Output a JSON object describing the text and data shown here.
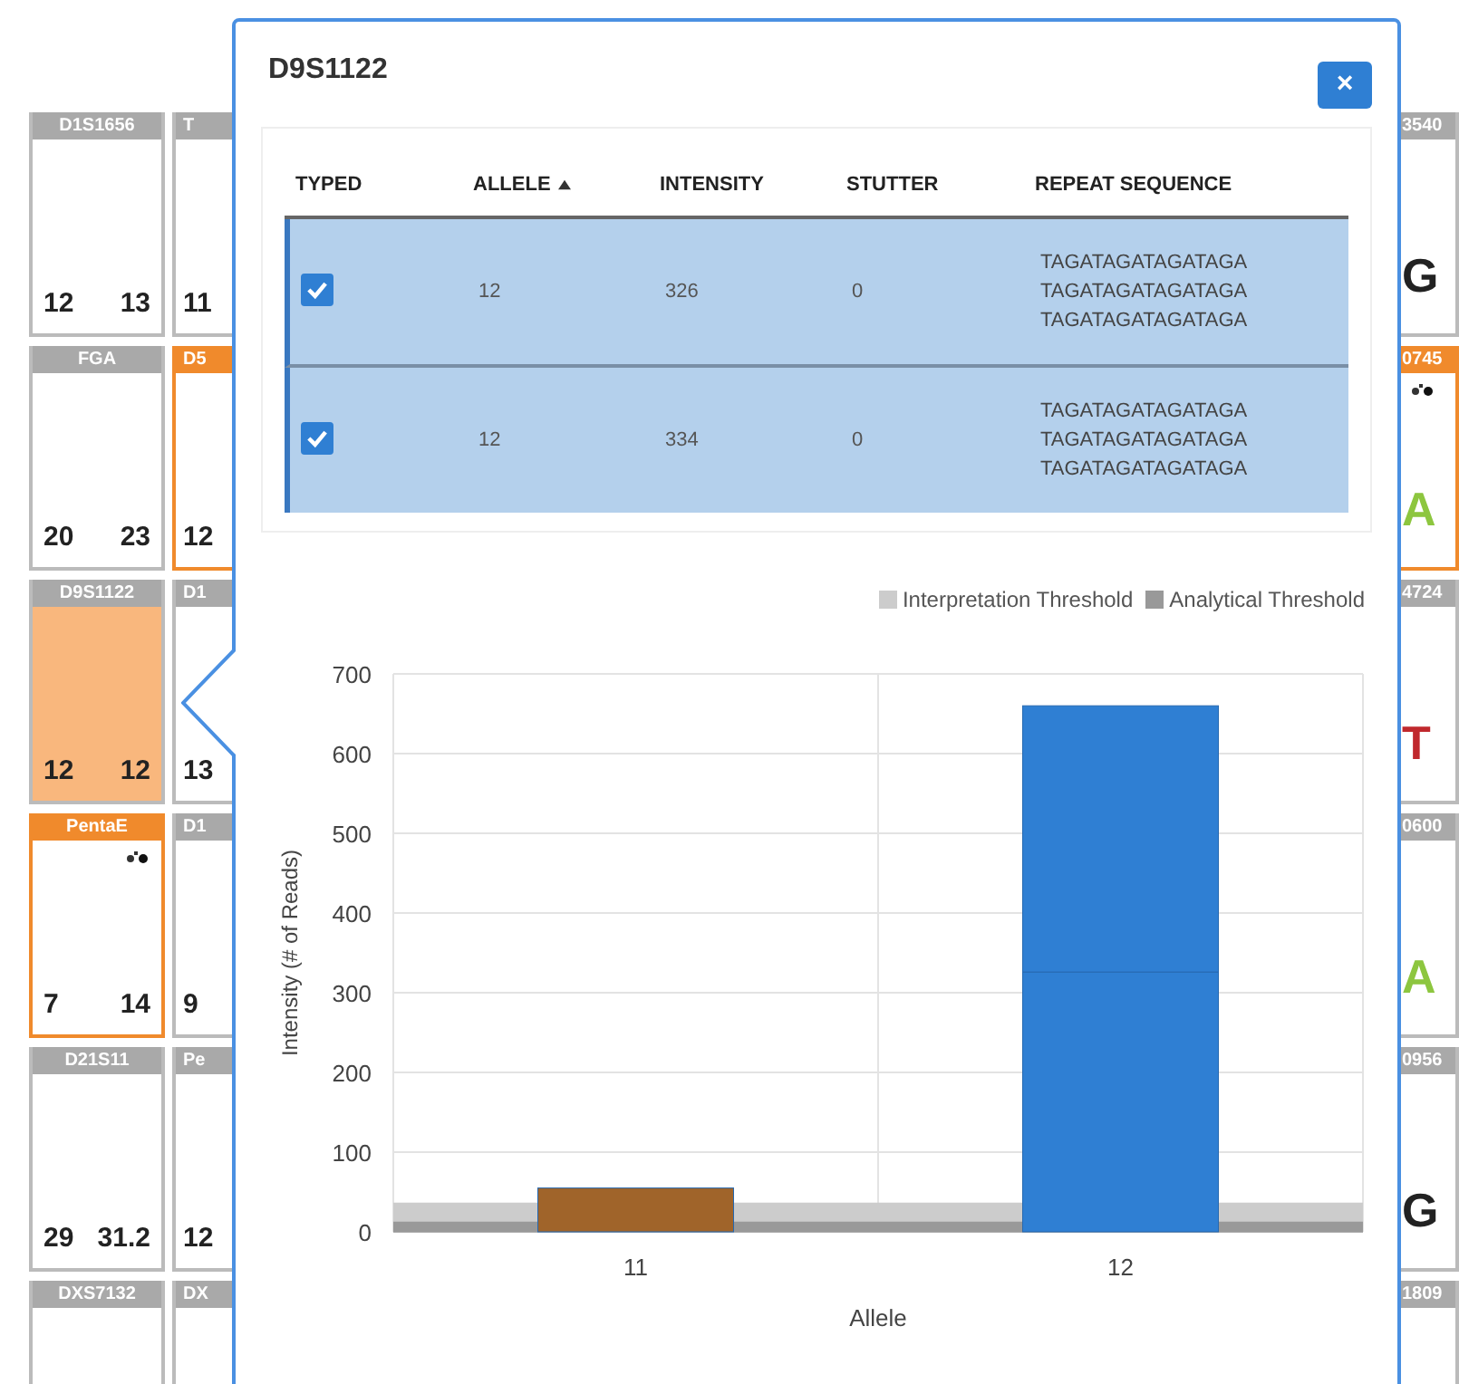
{
  "grid": {
    "columns": [
      {
        "cards": [
          {
            "locus": "D1S1656",
            "kind": "alleles",
            "values": [
              "12",
              "13"
            ],
            "flagged": false,
            "selected": false,
            "marker": false
          },
          {
            "locus": "FGA",
            "kind": "alleles",
            "values": [
              "20",
              "23"
            ],
            "flagged": false,
            "selected": false,
            "marker": false
          },
          {
            "locus": "D9S1122",
            "kind": "alleles",
            "values": [
              "12",
              "12"
            ],
            "flagged": false,
            "selected": true,
            "marker": false
          },
          {
            "locus": "PentaE",
            "kind": "alleles",
            "values": [
              "7",
              "14"
            ],
            "flagged": true,
            "selected": false,
            "marker": true
          },
          {
            "locus": "D21S11",
            "kind": "alleles",
            "values": [
              "29",
              "31.2"
            ],
            "flagged": false,
            "selected": false,
            "marker": false
          },
          {
            "locus": "DXS7132",
            "kind": "alleles",
            "flagged": false,
            "selected": false,
            "marker": false
          }
        ]
      },
      {
        "cards": [
          {
            "locus": "T",
            "kind": "alleles",
            "values": [
              "11"
            ],
            "flagged": false,
            "selected": false,
            "marker": false
          },
          {
            "locus": "D5",
            "kind": "alleles",
            "values": [
              "12"
            ],
            "flagged": true,
            "selected": false,
            "marker": false
          },
          {
            "locus": "D1",
            "kind": "alleles",
            "values": [
              "13"
            ],
            "flagged": false,
            "selected": false,
            "marker": false
          },
          {
            "locus": "D1",
            "kind": "alleles",
            "values": [
              "9"
            ],
            "flagged": false,
            "selected": false,
            "marker": false
          },
          {
            "locus": "Pe",
            "kind": "alleles",
            "values": [
              "12"
            ],
            "flagged": false,
            "selected": false,
            "marker": false
          },
          {
            "locus": "DX",
            "kind": "alleles",
            "flagged": false,
            "selected": false,
            "marker": false
          }
        ]
      },
      {
        "cards": [
          {
            "locus": "3540",
            "kind": "base",
            "call": "G",
            "color": "#222222",
            "flagged": false,
            "selected": false,
            "marker": false
          },
          {
            "locus": "0745",
            "kind": "base",
            "call": "A",
            "color": "#8dc63f",
            "flagged": true,
            "selected": false,
            "marker": true
          },
          {
            "locus": "4724",
            "kind": "base",
            "call": "T",
            "color": "#c0282d",
            "flagged": false,
            "selected": false,
            "marker": false
          },
          {
            "locus": "0600",
            "kind": "base",
            "call": "A",
            "color": "#8dc63f",
            "flagged": false,
            "selected": false,
            "marker": false
          },
          {
            "locus": "0956",
            "kind": "base",
            "call": "G",
            "color": "#222222",
            "flagged": false,
            "selected": false,
            "marker": false
          },
          {
            "locus": "1809",
            "kind": "base",
            "flagged": false,
            "selected": false,
            "marker": false
          }
        ]
      }
    ]
  },
  "popover": {
    "title": "D9S1122",
    "close": "×",
    "table": {
      "columns": [
        {
          "label": "TYPED",
          "sorted": false
        },
        {
          "label": "ALLELE",
          "sorted": true
        },
        {
          "label": "INTENSITY",
          "sorted": false
        },
        {
          "label": "STUTTER",
          "sorted": false
        },
        {
          "label": "REPEAT SEQUENCE",
          "sorted": false
        }
      ],
      "rows": [
        {
          "typed": true,
          "selected": true,
          "allele": "12",
          "intensity": "326",
          "stutter": "0",
          "sequence": [
            "TAGATAGATAGATAGA",
            "TAGATAGATAGATAGA",
            "TAGATAGATAGATAGA"
          ]
        },
        {
          "typed": true,
          "selected": true,
          "allele": "12",
          "intensity": "334",
          "stutter": "0",
          "sequence": [
            "TAGATAGATAGATAGA",
            "TAGATAGATAGATAGA",
            "TAGATAGATAGATAGA"
          ]
        }
      ]
    },
    "chart_data": {
      "type": "bar",
      "xlabel": "Allele",
      "ylabel": "Intensity (# of Reads)",
      "categories": [
        "11",
        "12"
      ],
      "stacked": true,
      "series": [
        {
          "color": "#a0642a",
          "values": [
            55,
            null
          ]
        },
        {
          "color": "#2f7fd3",
          "values": [
            null,
            326
          ]
        },
        {
          "color": "#2f7fd3",
          "values": [
            null,
            334
          ]
        }
      ],
      "ylim": [
        0,
        700
      ],
      "yticks": [
        0,
        100,
        200,
        300,
        400,
        500,
        600,
        700
      ],
      "grid": true,
      "ref_lines": [
        {
          "axis": "y",
          "value": 23,
          "label": "Interpretation Threshold",
          "color": "#cccccc"
        },
        {
          "axis": "y",
          "value": 6,
          "label": "Analytical Threshold",
          "color": "#999999"
        }
      ]
    }
  }
}
